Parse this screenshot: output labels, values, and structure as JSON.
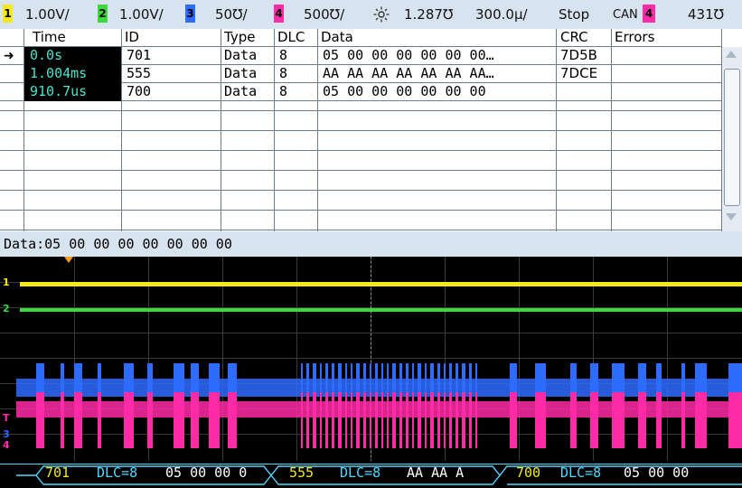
{
  "top_bar": {
    "ch1": {
      "num": "1",
      "scale": "1.00V/",
      "color": "#f5e91b"
    },
    "ch2": {
      "num": "2",
      "scale": "1.00V/",
      "color": "#3cd93c"
    },
    "ch3": {
      "num": "3",
      "scale": "50℧/"
    },
    "ch4": {
      "num": "4",
      "scale": "500℧/",
      "color": "#ff2aa6"
    },
    "trigger_level": "1.287℧",
    "timebase": "300.0µ/",
    "run_state": "Stop",
    "trigger_type": "CAN",
    "trigger_source": "4",
    "trigger_value": "431℧"
  },
  "table": {
    "headers": [
      "Time",
      "ID",
      "Type",
      "DLC",
      "Data",
      "CRC",
      "Errors"
    ],
    "rows": [
      {
        "time": "0.0s",
        "id": "701",
        "type": "Data",
        "dlc": "8",
        "data": "05 00 00 00 00 00 00…",
        "crc": "7D5B",
        "errors": ""
      },
      {
        "time": "1.004ms",
        "id": "555",
        "type": "Data",
        "dlc": "8",
        "data": "AA AA AA AA AA AA AA…",
        "crc": "7DCE",
        "errors": ""
      },
      {
        "time": "910.7us",
        "id": "700",
        "type": "Data",
        "dlc": "8",
        "data": "05 00 00 00 00 00 00",
        "crc": "",
        "errors": ""
      }
    ],
    "selected_row_marker": "➜"
  },
  "status": {
    "data_readout": "Data:05 00 00 00 00 00 00 00"
  },
  "waveform": {
    "channel_labels": [
      "1",
      "2",
      "3",
      "4",
      "T"
    ],
    "colors": {
      "ch1": "#f5e91b",
      "ch2": "#3cd93c",
      "blue": "#2e6bff",
      "pink": "#ff2aa6",
      "decode": "#4fd7ff"
    }
  },
  "decode": {
    "frame1": {
      "id": "701",
      "dlc": "DLC=8",
      "data": "05 00 00 0"
    },
    "frame2": {
      "id": "555",
      "dlc": "DLC=8",
      "data": "AA AA A"
    },
    "frame3": {
      "id": "700",
      "dlc": "DLC=8",
      "data": "05  00 00"
    }
  }
}
